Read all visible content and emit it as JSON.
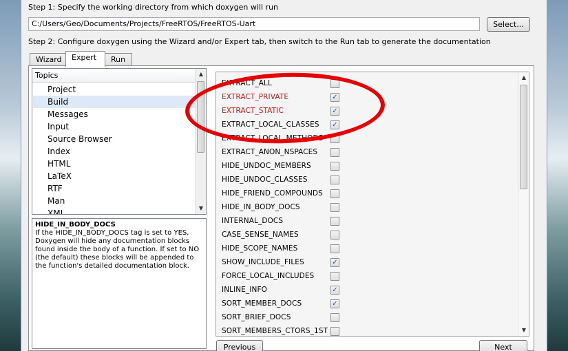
{
  "step1_text": "Step 1: Specify the working directory from which doxygen will run",
  "working_directory": "C:/Users/Geo/Documents/Projects/FreeRTOS/FreeRTOS-Uart",
  "select_label": "Select...",
  "step2_text": "Step 2: Configure doxygen using the Wizard and/or Expert tab, then switch to the Run tab to generate the documentation",
  "tabs": [
    {
      "label": "Wizard"
    },
    {
      "label": "Expert",
      "active": true
    },
    {
      "label": "Run"
    }
  ],
  "topics": {
    "header": "Topics",
    "items": [
      "Project",
      "Build",
      "Messages",
      "Input",
      "Source Browser",
      "Index",
      "HTML",
      "LaTeX",
      "RTF",
      "Man",
      "XML"
    ],
    "selected": "Build"
  },
  "help": {
    "title": "HIDE_IN_BODY_DOCS",
    "body": "If the HIDE_IN_BODY_DOCS tag is set to YES, Doxygen will hide any documentation blocks found inside the body of a function. If set to NO (the default) these blocks will be appended to the function's detailed documentation block."
  },
  "options": [
    {
      "name": "EXTRACT_ALL",
      "checked": false,
      "highlight": false
    },
    {
      "name": "EXTRACT_PRIVATE",
      "checked": true,
      "highlight": true
    },
    {
      "name": "EXTRACT_STATIC",
      "checked": true,
      "highlight": true
    },
    {
      "name": "EXTRACT_LOCAL_CLASSES",
      "checked": true,
      "highlight": false
    },
    {
      "name": "EXTRACT_LOCAL_METHODS",
      "checked": false,
      "highlight": false
    },
    {
      "name": "EXTRACT_ANON_NSPACES",
      "checked": false,
      "highlight": false
    },
    {
      "name": "HIDE_UNDOC_MEMBERS",
      "checked": false,
      "highlight": false
    },
    {
      "name": "HIDE_UNDOC_CLASSES",
      "checked": false,
      "highlight": false
    },
    {
      "name": "HIDE_FRIEND_COMPOUNDS",
      "checked": false,
      "highlight": false
    },
    {
      "name": "HIDE_IN_BODY_DOCS",
      "checked": false,
      "highlight": false
    },
    {
      "name": "INTERNAL_DOCS",
      "checked": false,
      "highlight": false
    },
    {
      "name": "CASE_SENSE_NAMES",
      "checked": false,
      "highlight": false
    },
    {
      "name": "HIDE_SCOPE_NAMES",
      "checked": false,
      "highlight": false
    },
    {
      "name": "SHOW_INCLUDE_FILES",
      "checked": true,
      "highlight": false
    },
    {
      "name": "FORCE_LOCAL_INCLUDES",
      "checked": false,
      "highlight": false
    },
    {
      "name": "INLINE_INFO",
      "checked": true,
      "highlight": false
    },
    {
      "name": "SORT_MEMBER_DOCS",
      "checked": true,
      "highlight": false
    },
    {
      "name": "SORT_BRIEF_DOCS",
      "checked": false,
      "highlight": false
    },
    {
      "name": "SORT_MEMBERS_CTORS_1ST",
      "checked": false,
      "highlight": false
    }
  ],
  "previous_label": "Previous",
  "next_label": "Next",
  "colors": {
    "highlight_text": "#e01010",
    "annotation": "#e80000",
    "selected_row": "#dde9f7"
  },
  "icons": {
    "scroll_up": "up-arrow",
    "scroll_down": "down-arrow",
    "check": "check-mark"
  }
}
